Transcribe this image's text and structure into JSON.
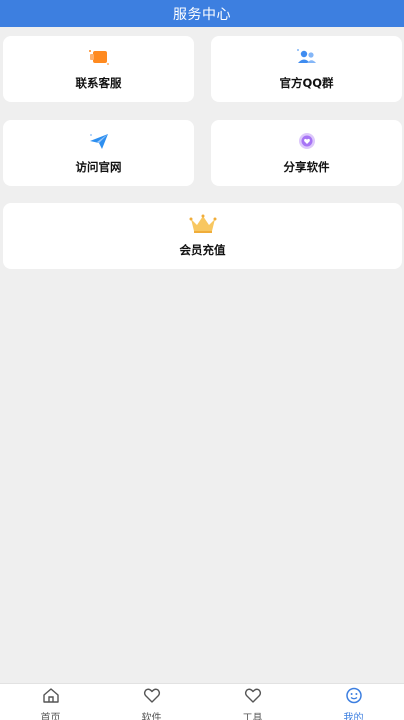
{
  "header": {
    "title": "服务中心"
  },
  "cards": [
    {
      "label": "联系客服",
      "icon": "customer-service-icon"
    },
    {
      "label": "官方QQ群",
      "icon": "group-icon"
    },
    {
      "label": "访问官网",
      "icon": "paper-plane-icon"
    },
    {
      "label": "分享软件",
      "icon": "share-heart-icon"
    },
    {
      "label": "会员充值",
      "icon": "crown-icon"
    }
  ],
  "tabs": [
    {
      "label": "首页",
      "icon": "home-icon",
      "active": false
    },
    {
      "label": "软件",
      "icon": "heart-icon",
      "active": false
    },
    {
      "label": "工具",
      "icon": "heart-icon",
      "active": false
    },
    {
      "label": "我的",
      "icon": "smile-icon",
      "active": true
    }
  ],
  "colors": {
    "accent": "#3d7fe0",
    "background": "#efefef"
  }
}
